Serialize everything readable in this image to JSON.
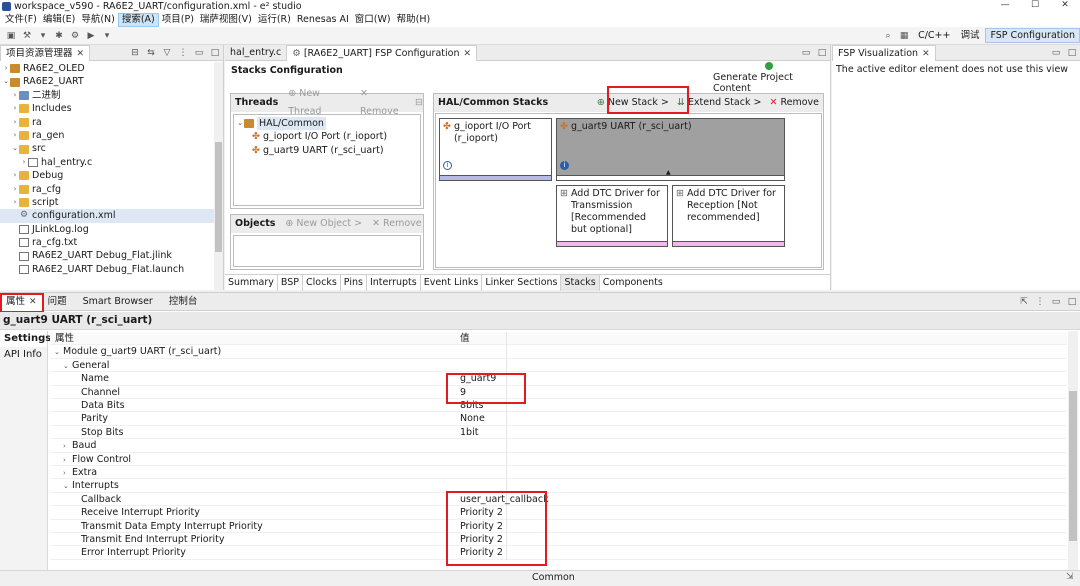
{
  "window": {
    "title": "workspace_v590 - RA6E2_UART/configuration.xml - e² studio",
    "controls": [
      "—",
      "☐",
      "✕"
    ]
  },
  "menu": [
    "文件(F)",
    "编辑(E)",
    "导航(N)",
    "搜索(A)",
    "项目(P)",
    "瑞萨视图(V)",
    "运行(R)",
    "Renesas AI",
    "窗口(W)",
    "帮助(H)"
  ],
  "perspectives": [
    "C/C++",
    "调试",
    "FSP Configuration"
  ],
  "explorer": {
    "tab": "项目资源管理器",
    "items": [
      {
        "label": "RA6E2_OLED",
        "indent": 0,
        "twisty": "›",
        "icon": "proj"
      },
      {
        "label": "RA6E2_UART",
        "indent": 0,
        "twisty": "⌄",
        "icon": "proj"
      },
      {
        "label": "二进制",
        "indent": 1,
        "twisty": "›",
        "icon": "bin"
      },
      {
        "label": "Includes",
        "indent": 1,
        "twisty": "›",
        "icon": "folder"
      },
      {
        "label": "ra",
        "indent": 1,
        "twisty": "›",
        "icon": "folder"
      },
      {
        "label": "ra_gen",
        "indent": 1,
        "twisty": "›",
        "icon": "folder"
      },
      {
        "label": "src",
        "indent": 1,
        "twisty": "⌄",
        "icon": "folder"
      },
      {
        "label": "hal_entry.c",
        "indent": 2,
        "twisty": "›",
        "icon": "file"
      },
      {
        "label": "Debug",
        "indent": 1,
        "twisty": "›",
        "icon": "folder"
      },
      {
        "label": "ra_cfg",
        "indent": 1,
        "twisty": "›",
        "icon": "folder"
      },
      {
        "label": "script",
        "indent": 1,
        "twisty": "›",
        "icon": "folder"
      },
      {
        "label": "configuration.xml",
        "indent": 1,
        "twisty": "",
        "icon": "gear"
      },
      {
        "label": "JLinkLog.log",
        "indent": 1,
        "twisty": "",
        "icon": "file"
      },
      {
        "label": "ra_cfg.txt",
        "indent": 1,
        "twisty": "",
        "icon": "file"
      },
      {
        "label": "RA6E2_UART Debug_Flat.jlink",
        "indent": 1,
        "twisty": "",
        "icon": "file"
      },
      {
        "label": "RA6E2_UART Debug_Flat.launch",
        "indent": 1,
        "twisty": "",
        "icon": "file"
      }
    ]
  },
  "editor": {
    "tabs": [
      "hal_entry.c",
      "[RA6E2_UART] FSP Configuration"
    ],
    "heading": "Stacks Configuration",
    "generate": "Generate Project Content",
    "threads": {
      "title": "Threads",
      "new": "New Thread",
      "remove": "Remove",
      "root": "HAL/Common",
      "children": [
        "g_ioport I/O Port (r_ioport)",
        "g_uart9 UART (r_sci_uart)"
      ]
    },
    "objects": {
      "title": "Objects",
      "new": "New Object >",
      "remove": "Remove"
    },
    "stacks": {
      "title": "HAL/Common Stacks",
      "new": "New Stack >",
      "extend": "Extend Stack >",
      "remove": "Remove",
      "module1": "g_ioport I/O Port (r_ioport)",
      "module2": "g_uart9 UART (r_sci_uart)",
      "dtc_tx": "Add DTC Driver for Transmission [Recommended but optional]",
      "dtc_rx": "Add DTC Driver for Reception [Not recommended]",
      "info": "i"
    },
    "bottom_tabs": [
      "Summary",
      "BSP",
      "Clocks",
      "Pins",
      "Interrupts",
      "Event Links",
      "Linker Sections",
      "Stacks",
      "Components"
    ]
  },
  "fspviz": {
    "tab": "FSP Visualization",
    "message": "The active editor element does not use this view"
  },
  "props": {
    "tabs": [
      "属性",
      "问题",
      "Smart Browser",
      "控制台"
    ],
    "title": "g_uart9 UART (r_sci_uart)",
    "side": [
      "Settings",
      "API Info"
    ],
    "col_key": "属性",
    "col_val": "值",
    "rows": [
      {
        "k": "Module g_uart9 UART (r_sci_uart)",
        "v": "",
        "lvl": 0,
        "tw": "⌄"
      },
      {
        "k": "General",
        "v": "",
        "lvl": 1,
        "tw": "⌄"
      },
      {
        "k": "Name",
        "v": "g_uart9",
        "lvl": 2,
        "tw": ""
      },
      {
        "k": "Channel",
        "v": "9",
        "lvl": 2,
        "tw": ""
      },
      {
        "k": "Data Bits",
        "v": "8bits",
        "lvl": 2,
        "tw": ""
      },
      {
        "k": "Parity",
        "v": "None",
        "lvl": 2,
        "tw": ""
      },
      {
        "k": "Stop Bits",
        "v": "1bit",
        "lvl": 2,
        "tw": ""
      },
      {
        "k": "Baud",
        "v": "",
        "lvl": 1,
        "tw": "›"
      },
      {
        "k": "Flow Control",
        "v": "",
        "lvl": 1,
        "tw": "›"
      },
      {
        "k": "Extra",
        "v": "",
        "lvl": 1,
        "tw": "›"
      },
      {
        "k": "Interrupts",
        "v": "",
        "lvl": 1,
        "tw": "⌄"
      },
      {
        "k": "Callback",
        "v": "user_uart_callback",
        "lvl": 2,
        "tw": ""
      },
      {
        "k": "Receive Interrupt Priority",
        "v": "Priority 2",
        "lvl": 2,
        "tw": ""
      },
      {
        "k": "Transmit Data Empty Interrupt Priority",
        "v": "Priority 2",
        "lvl": 2,
        "tw": ""
      },
      {
        "k": "Transmit End Interrupt Priority",
        "v": "Priority 2",
        "lvl": 2,
        "tw": ""
      },
      {
        "k": "Error Interrupt Priority",
        "v": "Priority 2",
        "lvl": 2,
        "tw": ""
      }
    ]
  },
  "status": {
    "text": "Common"
  },
  "colors": {
    "highlight": "#e01b24",
    "selected_module": "#a0a0a0",
    "stack_bar": "#b9b9e8",
    "dtc_bar": "#f2b8ec"
  }
}
